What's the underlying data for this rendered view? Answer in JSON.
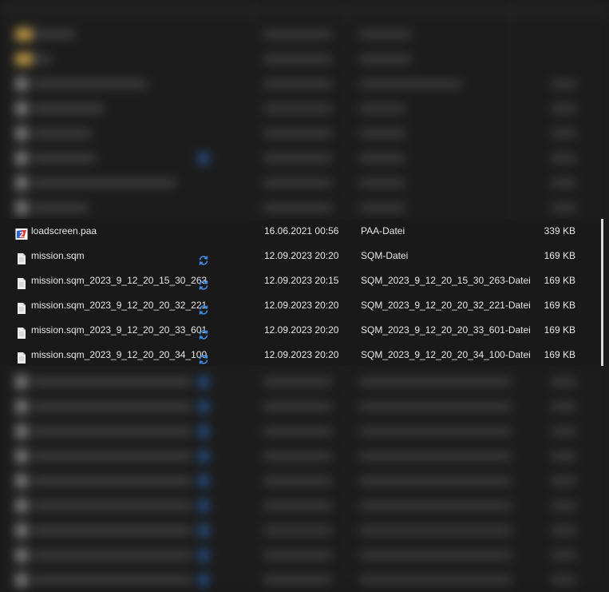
{
  "colors": {
    "background": "#191919",
    "text": "#e6e6e6",
    "sync_blue": "#3a8ee6",
    "file_icon": "#e8e8e8",
    "paa_icon_blue": "#2b5fd9",
    "paa_icon_red": "#e53935"
  },
  "files": [
    {
      "name": "loadscreen.paa",
      "icon": "paa-file-icon",
      "sync": false,
      "date": "16.06.2021 00:56",
      "type": "PAA-Datei",
      "size": "339 KB"
    },
    {
      "name": "mission.sqm",
      "icon": "document-icon",
      "sync": true,
      "date": "12.09.2023 20:20",
      "type": "SQM-Datei",
      "size": "169 KB"
    },
    {
      "name": "mission.sqm_2023_9_12_20_15_30_263",
      "icon": "document-icon",
      "sync": true,
      "date": "12.09.2023 20:15",
      "type": "SQM_2023_9_12_20_15_30_263-Datei",
      "size": "169 KB"
    },
    {
      "name": "mission.sqm_2023_9_12_20_20_32_221",
      "icon": "document-icon",
      "sync": true,
      "date": "12.09.2023 20:20",
      "type": "SQM_2023_9_12_20_20_32_221-Datei",
      "size": "169 KB"
    },
    {
      "name": "mission.sqm_2023_9_12_20_20_33_601",
      "icon": "document-icon",
      "sync": true,
      "date": "12.09.2023 20:20",
      "type": "SQM_2023_9_12_20_20_33_601-Datei",
      "size": "169 KB"
    },
    {
      "name": "mission.sqm_2023_9_12_20_20_34_100",
      "icon": "document-icon",
      "sync": true,
      "date": "12.09.2023 20:20",
      "type": "SQM_2023_9_12_20_20_34_100-Datei",
      "size": "169 KB"
    }
  ]
}
